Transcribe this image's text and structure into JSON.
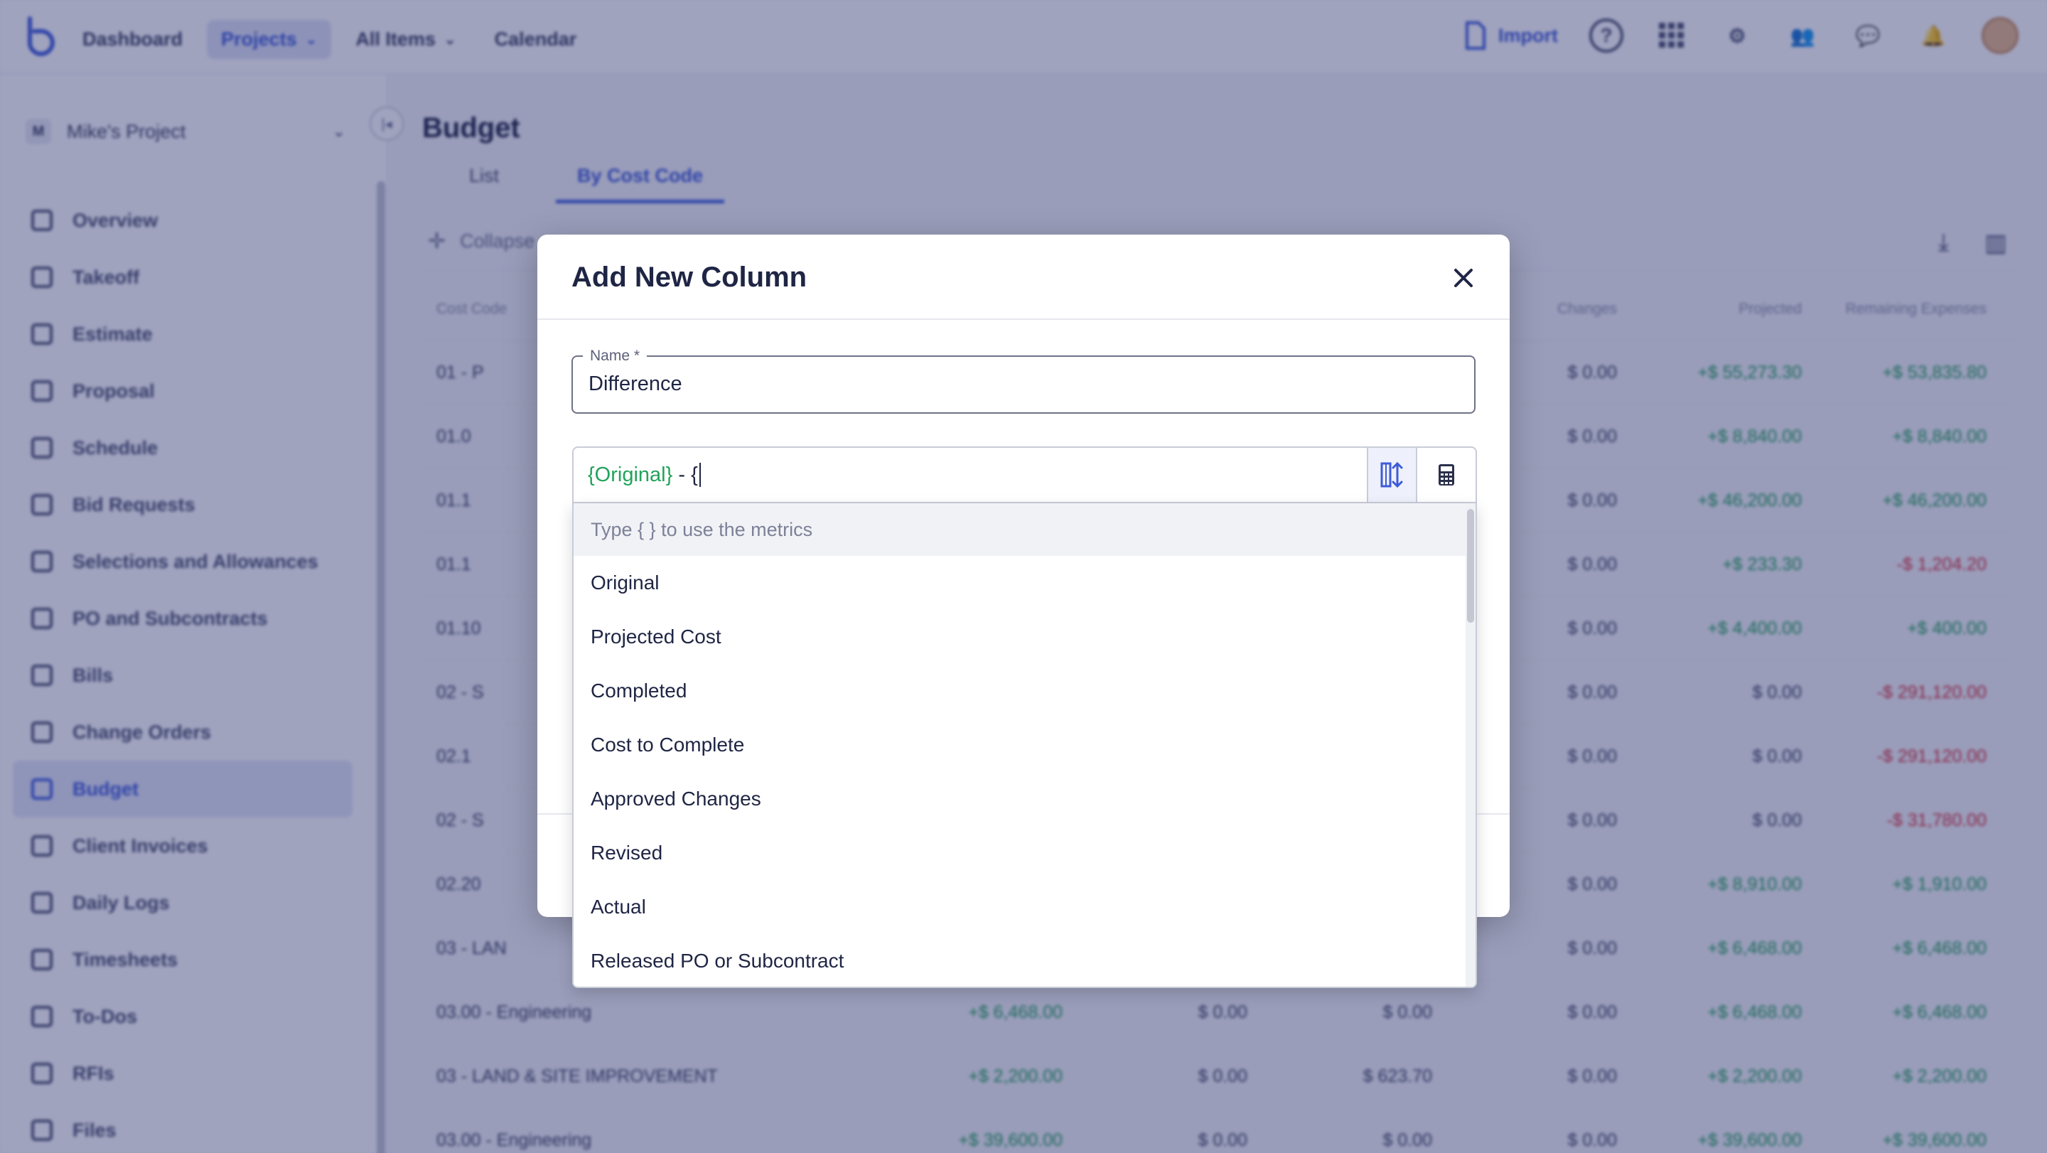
{
  "topnav": {
    "items": [
      {
        "label": "Dashboard"
      },
      {
        "label": "Projects"
      },
      {
        "label": "All Items"
      },
      {
        "label": "Calendar"
      }
    ],
    "import_label": "Import"
  },
  "sidebar": {
    "project_badge": "M",
    "project_name": "Mike's Project",
    "items": [
      {
        "label": "Overview"
      },
      {
        "label": "Takeoff"
      },
      {
        "label": "Estimate"
      },
      {
        "label": "Proposal"
      },
      {
        "label": "Schedule"
      },
      {
        "label": "Bid Requests"
      },
      {
        "label": "Selections and Allowances"
      },
      {
        "label": "PO and Subcontracts"
      },
      {
        "label": "Bills"
      },
      {
        "label": "Change Orders"
      },
      {
        "label": "Budget"
      },
      {
        "label": "Client Invoices"
      },
      {
        "label": "Daily Logs"
      },
      {
        "label": "Timesheets"
      },
      {
        "label": "To-Dos"
      },
      {
        "label": "RFIs"
      },
      {
        "label": "Files"
      }
    ]
  },
  "page": {
    "title": "Budget",
    "tabs": [
      {
        "label": "List"
      },
      {
        "label": "By Cost Code"
      }
    ],
    "collapse_label": "Collapse"
  },
  "grid": {
    "headers": [
      "Cost Code",
      "",
      "",
      "",
      "Changes",
      "Projected",
      "Remaining Expenses"
    ],
    "rows": [
      {
        "code": "01 - P",
        "a": "",
        "b": "",
        "c": "",
        "d": "$ 0.00",
        "e": "+$ 55,273.30",
        "f": "+$ 53,835.80"
      },
      {
        "code": "01.0",
        "a": "",
        "b": "",
        "c": "",
        "d": "$ 0.00",
        "e": "+$ 8,840.00",
        "f": "+$ 8,840.00"
      },
      {
        "code": "01.1",
        "a": "",
        "b": "",
        "c": "",
        "d": "$ 0.00",
        "e": "+$ 46,200.00",
        "f": "+$ 46,200.00"
      },
      {
        "code": "01.1",
        "a": "",
        "b": "",
        "c": "",
        "d": "$ 0.00",
        "e": "+$ 233.30",
        "f": "-$ 1,204.20"
      },
      {
        "code": "01.10",
        "a": "",
        "b": "",
        "c": "",
        "d": "$ 0.00",
        "e": "+$ 4,400.00",
        "f": "+$ 400.00"
      },
      {
        "code": "02 - S",
        "a": "",
        "b": "",
        "c": "",
        "d": "$ 0.00",
        "e": "$ 0.00",
        "f": "-$ 291,120.00"
      },
      {
        "code": "02.1",
        "a": "",
        "b": "",
        "c": "",
        "d": "$ 0.00",
        "e": "$ 0.00",
        "f": "-$ 291,120.00"
      },
      {
        "code": "02 - S",
        "a": "",
        "b": "",
        "c": "",
        "d": "$ 0.00",
        "e": "$ 0.00",
        "f": "-$ 31,780.00"
      },
      {
        "code": "02.20",
        "a": "",
        "b": "",
        "c": "",
        "d": "$ 0.00",
        "e": "+$ 8,910.00",
        "f": "+$ 1,910.00"
      },
      {
        "code": "03 - LAN",
        "a": "",
        "b": "",
        "c": "",
        "d": "$ 0.00",
        "e": "+$ 6,468.00",
        "f": "+$ 6,468.00"
      },
      {
        "code": "03.00 - Engineering",
        "a": "+$ 6,468.00",
        "b": "$ 0.00",
        "c": "$ 0.00",
        "d": "$ 0.00",
        "e": "+$ 6,468.00",
        "f": "+$ 6,468.00"
      },
      {
        "code": "03 - LAND & SITE IMPROVEMENT",
        "a": "+$ 2,200.00",
        "b": "$ 0.00",
        "c": "$ 623.70",
        "d": "$ 0.00",
        "e": "+$ 2,200.00",
        "f": "+$ 2,200.00"
      },
      {
        "code": "03.00 - Engineering",
        "a": "+$ 39,600.00",
        "b": "$ 0.00",
        "c": "$ 0.00",
        "d": "$ 0.00",
        "e": "+$ 39,600.00",
        "f": "+$ 39,600.00"
      }
    ]
  },
  "modal": {
    "title": "Add New Column",
    "name_label": "Name *",
    "name_value": "Difference",
    "formula_token": "{Original}",
    "formula_rest": " - {",
    "dropdown_hint": "Type { } to use the metrics",
    "metrics": [
      {
        "label": "Original"
      },
      {
        "label": "Projected Cost"
      },
      {
        "label": "Completed"
      },
      {
        "label": "Cost to Complete"
      },
      {
        "label": "Approved Changes"
      },
      {
        "label": "Revised"
      },
      {
        "label": "Actual"
      },
      {
        "label": "Released PO or Subcontract"
      }
    ]
  },
  "colors": {
    "accent": "#3d5bd9",
    "positive": "#1f9d55",
    "negative": "#d92d3a",
    "metric_token": "#22a35a"
  }
}
